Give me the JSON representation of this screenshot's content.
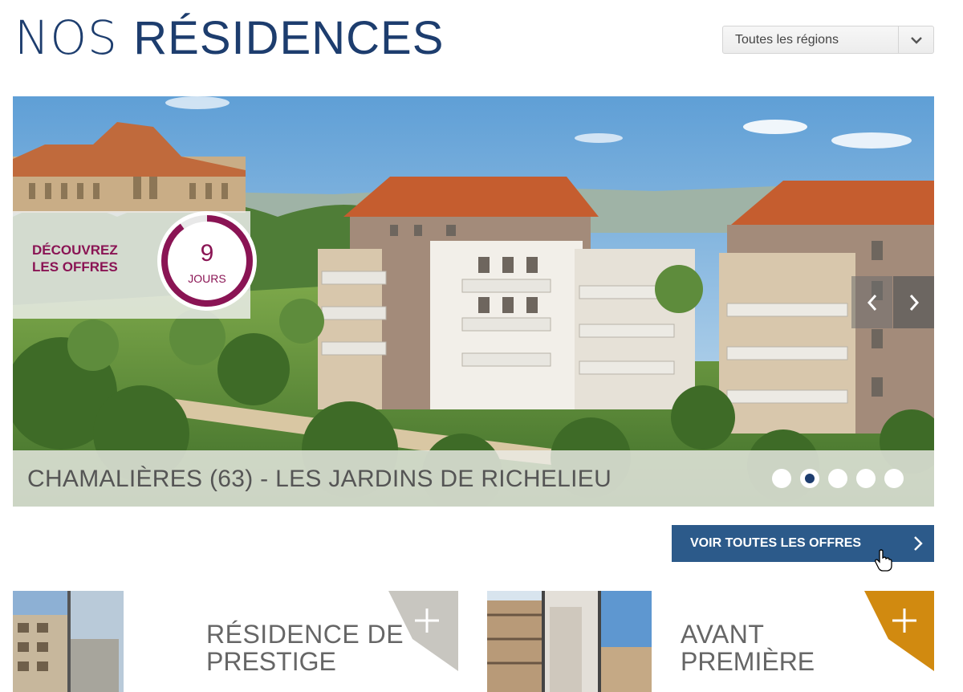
{
  "header": {
    "title_light": "NOS",
    "title_bold": "RÉSIDENCES"
  },
  "region_filter": {
    "selected": "Toutes les régions"
  },
  "hero": {
    "promo_line1": "DÉCOUVREZ",
    "promo_line2": "LES OFFRES",
    "countdown_value": "9",
    "countdown_unit": "JOURS",
    "countdown_progress": 0.9,
    "caption": "CHAMALIÈRES (63) - LES JARDINS DE RICHELIEU",
    "slide_count": 5,
    "active_slide": 2
  },
  "cta": {
    "label": "VOIR TOUTES LES OFFRES"
  },
  "cards": [
    {
      "line1": "RÉSIDENCE DE",
      "line2": "PRESTIGE",
      "accent": "#c8c6c0"
    },
    {
      "line1": "AVANT",
      "line2": "PREMIÈRE",
      "accent": "#d18a10"
    }
  ],
  "colors": {
    "brand_blue": "#1d3d6e",
    "cta_blue": "#2c5a8a",
    "promo_magenta": "#8a1454"
  }
}
